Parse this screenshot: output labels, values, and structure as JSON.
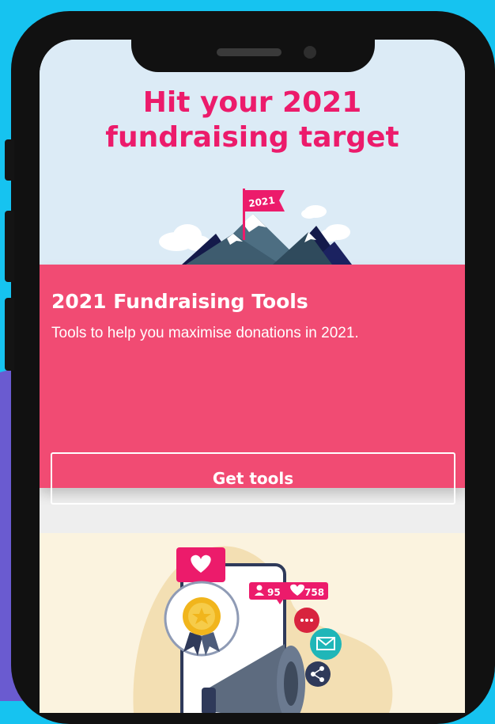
{
  "banner": {
    "title": "Hit your 2021 fundraising target",
    "flag_text": "2021"
  },
  "card": {
    "title": "2021 Fundraising Tools",
    "description": "Tools to help you maximise donations in 2021.",
    "button_label": "Get tools"
  },
  "promo": {
    "followers_count": "95",
    "likes_count": "758"
  },
  "colors": {
    "accent_pink": "#ec1b6b",
    "card_pink": "#f14b73",
    "banner_bg": "#dcebf6",
    "page_bg": "#16c3f0",
    "promo_bg": "#fbf3df"
  },
  "icons": [
    "mountain-flag-illustration",
    "heart-icon",
    "medal-icon",
    "person-icon",
    "megaphone-icon",
    "chat-icon",
    "mail-icon",
    "share-icon"
  ]
}
